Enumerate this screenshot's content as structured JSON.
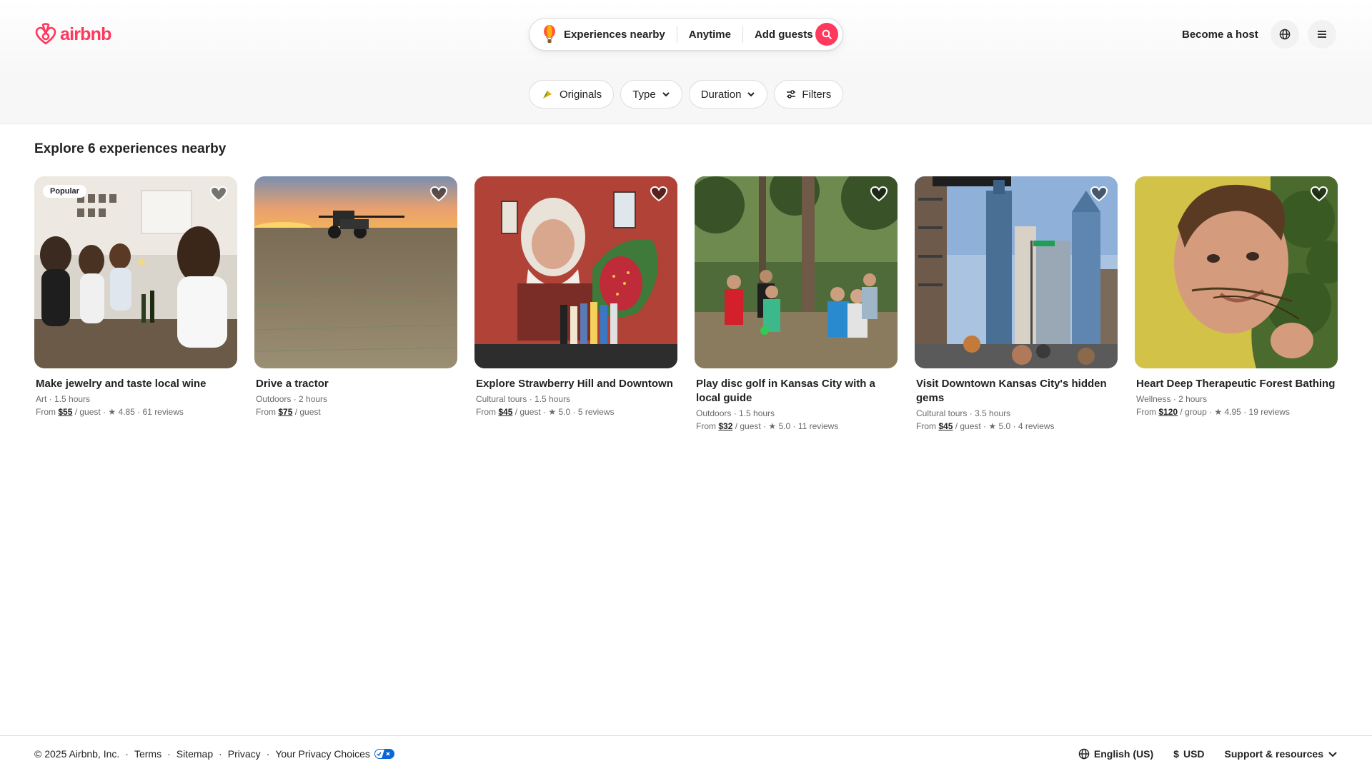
{
  "brand": {
    "name": "airbnb",
    "color": "#ff385c"
  },
  "search": {
    "location": "Experiences nearby",
    "dates": "Anytime",
    "guests": "Add guests"
  },
  "header": {
    "become_host": "Become a host"
  },
  "filters": [
    {
      "label": "Originals"
    },
    {
      "label": "Type"
    },
    {
      "label": "Duration"
    },
    {
      "label": "Filters"
    }
  ],
  "main": {
    "title": "Explore 6 experiences nearby",
    "cards": [
      {
        "title": "Make jewelry and taste local wine",
        "meta": "Art · 1.5 hours",
        "price_prefix": "From ",
        "price": "$55",
        "price_suffix": " / guest · ★ 4.85 · 61 reviews",
        "badge": "Popular"
      },
      {
        "title": "Drive a tractor",
        "meta": "Outdoors · 2 hours",
        "price_prefix": "From ",
        "price": "$75",
        "price_suffix": " / guest"
      },
      {
        "title": "Explore Strawberry Hill and Downtown",
        "meta": "Cultural tours · 1.5 hours",
        "price_prefix": "From ",
        "price": "$45",
        "price_suffix": " / guest · ★ 5.0 · 5 reviews"
      },
      {
        "title": "Play disc golf in Kansas City with a local guide",
        "meta": "Outdoors · 1.5 hours",
        "price_prefix": "From ",
        "price": "$32",
        "price_suffix": " / guest · ★ 5.0 · 11 reviews"
      },
      {
        "title": "Visit Downtown Kansas City's hidden gems",
        "meta": "Cultural tours · 3.5 hours",
        "price_prefix": "From ",
        "price": "$45",
        "price_suffix": " / guest · ★ 5.0 · 4 reviews"
      },
      {
        "title": "Heart Deep Therapeutic Forest Bathing",
        "meta": "Wellness · 2 hours",
        "price_prefix": "From ",
        "price": "$120",
        "price_suffix": " / group · ★ 4.95 · 19 reviews"
      }
    ]
  },
  "footer": {
    "copyright": "© 2025 Airbnb, Inc.",
    "terms": "Terms",
    "sitemap": "Sitemap",
    "privacy": "Privacy",
    "privacy_choices": "Your Privacy Choices",
    "language": "English (US)",
    "currency_symbol": "$",
    "currency": "USD",
    "support": "Support & resources"
  }
}
